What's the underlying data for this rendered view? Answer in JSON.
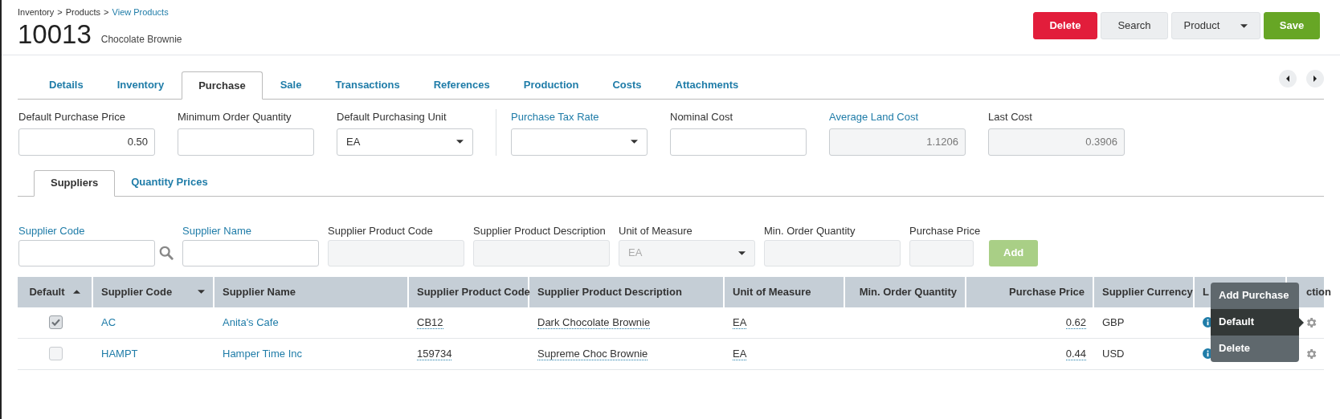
{
  "breadcrumb": [
    {
      "kind": "text",
      "text": "Inventory"
    },
    {
      "kind": "separator",
      "text": ">"
    },
    {
      "kind": "text",
      "text": "Products"
    },
    {
      "kind": "separator",
      "text": ">"
    },
    {
      "kind": "link",
      "text": "View Products"
    }
  ],
  "title": {
    "number": "10013",
    "name": "Chocolate Brownie"
  },
  "actions": [
    {
      "kind": "danger",
      "label": "Delete"
    },
    {
      "kind": "plain",
      "label": "Search"
    },
    {
      "kind": "dropdown",
      "label": "Product"
    },
    {
      "kind": "success",
      "label": "Save"
    }
  ],
  "tabs": [
    {
      "label": "Details",
      "selected": false
    },
    {
      "label": "Inventory",
      "selected": false
    },
    {
      "label": "Purchase",
      "selected": true
    },
    {
      "label": "Sale",
      "selected": false
    },
    {
      "label": "Transactions",
      "selected": false
    },
    {
      "label": "References",
      "selected": false
    },
    {
      "label": "Production",
      "selected": false
    },
    {
      "label": "Costs",
      "selected": false
    },
    {
      "label": "Attachments",
      "selected": false
    }
  ],
  "fields": [
    {
      "kind": "input",
      "label": "Default Purchase Price",
      "value": "0.50",
      "link": false,
      "divider_before": false
    },
    {
      "kind": "input",
      "label": "Minimum Order Quantity",
      "link": false,
      "divider_before": false
    },
    {
      "kind": "select",
      "label": "Default Purchasing Unit",
      "value": "EA",
      "link": false,
      "divider_before": false
    },
    {
      "kind": "select",
      "label": "Purchase Tax Rate",
      "link": true,
      "divider_before": true
    },
    {
      "kind": "input",
      "label": "Nominal Cost",
      "link": false,
      "divider_before": false
    },
    {
      "kind": "readonly",
      "label": "Average Land Cost",
      "value": "1.1206",
      "link": true,
      "divider_before": false
    },
    {
      "kind": "readonly",
      "label": "Last Cost",
      "value": "0.3906",
      "link": false,
      "divider_before": false
    }
  ],
  "subtabs": [
    {
      "label": "Suppliers",
      "selected": true
    },
    {
      "label": "Quantity Prices",
      "selected": false
    }
  ],
  "supplier_form": [
    {
      "kind": "lookup",
      "label": "Supplier Code",
      "link": true
    },
    {
      "kind": "input",
      "label": "Supplier Name",
      "link": true
    },
    {
      "kind": "readonly",
      "label": "Supplier Product Code",
      "link": false
    },
    {
      "kind": "readonly",
      "label": "Supplier Product Description",
      "link": false
    },
    {
      "kind": "select",
      "label": "Unit of Measure",
      "value": "EA",
      "link": false
    },
    {
      "kind": "readonly",
      "label": "Min. Order Quantity",
      "link": false
    },
    {
      "kind": "readonly-small",
      "label": "Purchase Price",
      "link": false
    },
    {
      "kind": "button",
      "label": "Add"
    }
  ],
  "table": {
    "columns": [
      {
        "kind": "checkbox",
        "label": "Default",
        "sorted": true,
        "menu": false
      },
      {
        "kind": "link",
        "label": "Supplier Code",
        "sorted": false,
        "menu": true
      },
      {
        "kind": "link",
        "label": "Supplier Name",
        "sorted": false,
        "menu": false
      },
      {
        "kind": "editable",
        "label": "Supplier Product Code",
        "sorted": false,
        "menu": false
      },
      {
        "kind": "editable",
        "label": "Supplier Product Description",
        "sorted": false,
        "menu": false
      },
      {
        "kind": "editable",
        "label": "Unit of Measure",
        "sorted": false,
        "menu": false
      },
      {
        "kind": "number",
        "label": "Min. Order Quantity",
        "sorted": false,
        "menu": false
      },
      {
        "kind": "editable-number",
        "label": "Purchase Price",
        "sorted": false,
        "menu": false
      },
      {
        "kind": "text",
        "label": "Supplier Currency",
        "sorted": false,
        "menu": false
      },
      {
        "kind": "info",
        "label": "L",
        "sorted": false,
        "menu": false
      },
      {
        "kind": "action",
        "label": "ction",
        "sorted": false,
        "menu": false
      }
    ],
    "rows": [
      {
        "checked": true,
        "cells": [
          "",
          "AC",
          "Anita's Cafe",
          "CB12",
          "Dark Chocolate Brownie",
          "EA",
          "",
          "0.62",
          "GBP",
          "",
          ""
        ]
      },
      {
        "checked": false,
        "cells": [
          "",
          "HAMPT",
          "Hamper Time Inc",
          "159734",
          "Supreme Choc Brownie",
          "EA",
          "",
          "0.44",
          "USD",
          "",
          ""
        ]
      }
    ]
  },
  "action_menu": {
    "items": [
      {
        "label": "Add Purchase",
        "selected": false
      },
      {
        "label": "Default",
        "selected": true
      },
      {
        "label": "Delete",
        "selected": false
      }
    ]
  }
}
